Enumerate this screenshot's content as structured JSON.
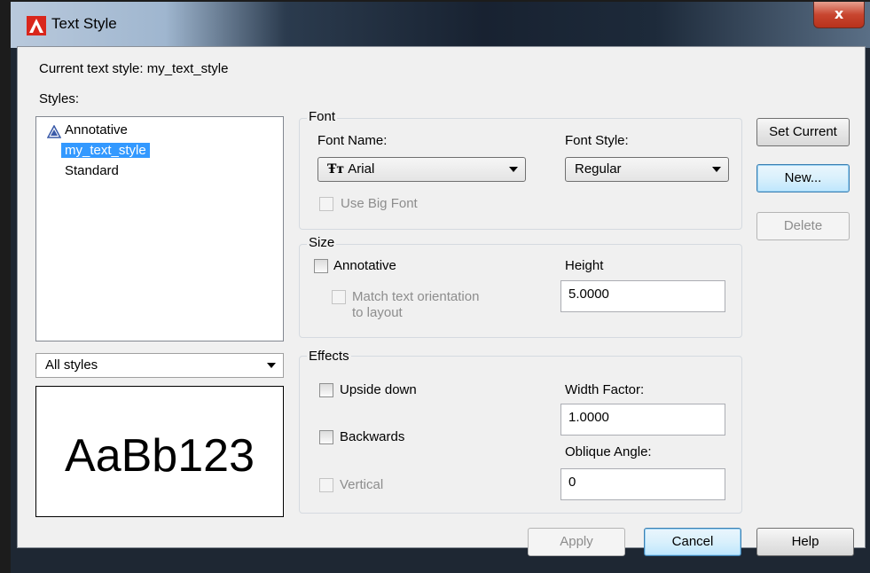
{
  "window": {
    "title": "Text Style",
    "close_glyph": "x"
  },
  "current_style": {
    "label": "Current text style:",
    "value": "my_text_style"
  },
  "styles": {
    "label": "Styles:",
    "items": [
      {
        "label": "Annotative",
        "icon": "annotative-icon"
      },
      {
        "label": "my_text_style",
        "selected": true
      },
      {
        "label": "Standard"
      }
    ],
    "filter": "All styles"
  },
  "preview": {
    "text": "AaBb123"
  },
  "font": {
    "group_label": "Font",
    "name_label": "Font Name:",
    "name_value": "Arial",
    "style_label": "Font Style:",
    "style_value": "Regular",
    "big_font_label": "Use Big Font"
  },
  "size": {
    "group_label": "Size",
    "annotative_label": "Annotative",
    "match_label_1": "Match text orientation",
    "match_label_2": "to layout",
    "height_label": "Height",
    "height_value": "5.0000"
  },
  "effects": {
    "group_label": "Effects",
    "upside_down_label": "Upside down",
    "backwards_label": "Backwards",
    "vertical_label": "Vertical",
    "width_factor_label": "Width Factor:",
    "width_factor_value": "1.0000",
    "oblique_label": "Oblique Angle:",
    "oblique_value": "0"
  },
  "buttons": {
    "set_current": "Set Current",
    "new": "New...",
    "delete": "Delete",
    "apply": "Apply",
    "cancel": "Cancel",
    "help": "Help"
  },
  "colors": {
    "selection": "#3399ff",
    "app_icon": "#d9261c"
  }
}
